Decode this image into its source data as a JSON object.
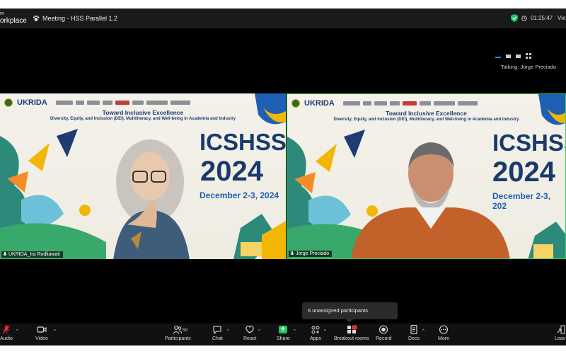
{
  "window": {
    "brand_line1": "m",
    "brand_line2": "orkplace",
    "meeting_title": "Meeting - HSS Parallel 1.2",
    "timer": "01:25:47",
    "view_label": "Vie"
  },
  "speaker": {
    "talking_label": "Talking: Jorge Preciado"
  },
  "banner": {
    "university": "UKRIDA",
    "headline": "Toward Inclusive Excellence",
    "subheadline": "Diversity, Equity, and Inclusion (DEI), Multiliteracy, and Well-being in Academia and Industry",
    "event_name": "ICSHSS",
    "event_year": "2024",
    "event_dates_1": "December 2-3, 2024",
    "event_dates_2": "December 2-3, 202"
  },
  "participants": [
    {
      "name": "UKRIDA_Ira Rodliawati"
    },
    {
      "name": "Jorge Preciado"
    }
  ],
  "tooltip": {
    "text": "6 unassigned participants"
  },
  "toolbar": {
    "audio": "Audio",
    "video": "Video",
    "participants": "Participants",
    "participants_count": "50",
    "chat": "Chat",
    "react": "React",
    "share": "Share",
    "apps": "Apps",
    "breakout": "Breakout rooms",
    "record": "Record",
    "docs": "Docs",
    "more": "More",
    "leave": "Leav"
  },
  "colors": {
    "accent_green": "#39d353",
    "share_green": "#22c55e",
    "mute_red": "#e03131",
    "banner_navy": "#1b3a6b"
  }
}
